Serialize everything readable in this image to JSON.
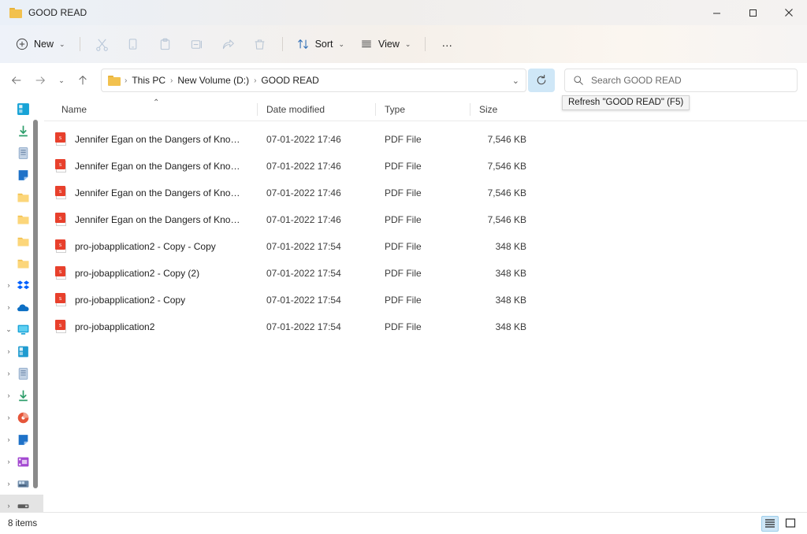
{
  "window": {
    "title": "GOOD READ",
    "folder_icon": "folder-icon",
    "controls": {
      "minimize": "minimize-icon",
      "maximize": "maximize-icon",
      "close": "close-icon"
    }
  },
  "commandbar": {
    "new_label": "New",
    "new_caret": "⌄",
    "cut_label": "Cut",
    "copy_label": "Copy",
    "paste_label": "Paste",
    "rename_label": "Rename",
    "share_label": "Share",
    "delete_label": "Delete",
    "sort_label": "Sort",
    "sort_caret": "⌄",
    "view_label": "View",
    "view_caret": "⌄",
    "more_label": "…"
  },
  "address": {
    "back": "back-arrow",
    "forward": "forward-arrow",
    "recent": "⌄",
    "up": "up-arrow",
    "breadcrumbs": [
      {
        "label": "This PC"
      },
      {
        "label": "New Volume (D:)"
      },
      {
        "label": "GOOD READ"
      }
    ],
    "separator": "›",
    "dropdown_caret": "⌄",
    "refresh_icon": "refresh-icon",
    "refresh_highlight_color": "#cfe7f7"
  },
  "tooltip": {
    "text": "Refresh \"GOOD READ\" (F5)",
    "visible": true
  },
  "search": {
    "placeholder": "Search GOOD READ",
    "icon": "search-icon"
  },
  "sidebar": {
    "scrollbar_color": "#8a8a8a",
    "items": [
      {
        "caret": "",
        "icon": "onedrive-personal-icon",
        "color": "#1976d2"
      },
      {
        "caret": "",
        "icon": "downloads-icon",
        "color": "#2e9e6b"
      },
      {
        "caret": "",
        "icon": "documents-icon",
        "color": "#8aa6c8"
      },
      {
        "caret": "",
        "icon": "pictures-icon",
        "color": "#1f72c8"
      },
      {
        "caret": "",
        "icon": "folder-icon",
        "color": "#f2c14e"
      },
      {
        "caret": "",
        "icon": "folder-icon",
        "color": "#f2c14e"
      },
      {
        "caret": "",
        "icon": "folder-icon",
        "color": "#f2c14e"
      },
      {
        "caret": "",
        "icon": "folder-icon",
        "color": "#f2c14e"
      },
      {
        "caret": "›",
        "icon": "dropbox-icon",
        "color": "#0061fe"
      },
      {
        "caret": "›",
        "icon": "onedrive-cloud-icon",
        "color": "#0d6fc4"
      },
      {
        "caret": "⌄",
        "icon": "this-pc-icon",
        "color": "#1aa3d8"
      },
      {
        "caret": "›",
        "icon": "drive-icon",
        "color": "#1f9bd0"
      },
      {
        "caret": "›",
        "icon": "documents-icon",
        "color": "#8aa6c8"
      },
      {
        "caret": "›",
        "icon": "downloads-icon",
        "color": "#2e9e6b"
      },
      {
        "caret": "›",
        "icon": "music-icon",
        "color": "#e5563a"
      },
      {
        "caret": "›",
        "icon": "pictures-icon",
        "color": "#1f72c8"
      },
      {
        "caret": "›",
        "icon": "videos-icon",
        "color": "#a349d1"
      },
      {
        "caret": "›",
        "icon": "local-disk-icon",
        "color": "#5f7a9c"
      },
      {
        "caret": "›",
        "icon": "new-volume-icon",
        "color": "#6e6e6e",
        "selected": true
      }
    ]
  },
  "columns": [
    {
      "key": "name",
      "label": "Name",
      "sorted": true,
      "sort_direction": "ascending",
      "sort_glyph": "⌃"
    },
    {
      "key": "date",
      "label": "Date modified"
    },
    {
      "key": "type",
      "label": "Type"
    },
    {
      "key": "size",
      "label": "Size"
    }
  ],
  "files": [
    {
      "icon": "pdf-file-icon",
      "badge": "s",
      "name": "Jennifer Egan on the Dangers of Knowing…",
      "date": "07-01-2022 17:46",
      "type": "PDF File",
      "size": "7,546 KB"
    },
    {
      "icon": "pdf-file-icon",
      "badge": "s",
      "name": "Jennifer Egan on the Dangers of Knowing…",
      "date": "07-01-2022 17:46",
      "type": "PDF File",
      "size": "7,546 KB"
    },
    {
      "icon": "pdf-file-icon",
      "badge": "s",
      "name": "Jennifer Egan on the Dangers of Knowing…",
      "date": "07-01-2022 17:46",
      "type": "PDF File",
      "size": "7,546 KB"
    },
    {
      "icon": "pdf-file-icon",
      "badge": "s",
      "name": "Jennifer Egan on the Dangers of Knowing…",
      "date": "07-01-2022 17:46",
      "type": "PDF File",
      "size": "7,546 KB"
    },
    {
      "icon": "pdf-file-icon",
      "badge": "s",
      "name": "pro-jobapplication2 - Copy - Copy",
      "date": "07-01-2022 17:54",
      "type": "PDF File",
      "size": "348 KB"
    },
    {
      "icon": "pdf-file-icon",
      "badge": "s",
      "name": "pro-jobapplication2 - Copy (2)",
      "date": "07-01-2022 17:54",
      "type": "PDF File",
      "size": "348 KB"
    },
    {
      "icon": "pdf-file-icon",
      "badge": "s",
      "name": "pro-jobapplication2 - Copy",
      "date": "07-01-2022 17:54",
      "type": "PDF File",
      "size": "348 KB"
    },
    {
      "icon": "pdf-file-icon",
      "badge": "s",
      "name": "pro-jobapplication2",
      "date": "07-01-2022 17:54",
      "type": "PDF File",
      "size": "348 KB"
    }
  ],
  "statusbar": {
    "item_count": "8 items",
    "details_view": "details-view-icon",
    "large_icons_view": "large-icons-view-icon",
    "active_view": "details",
    "active_color": "#cfe7f7"
  }
}
